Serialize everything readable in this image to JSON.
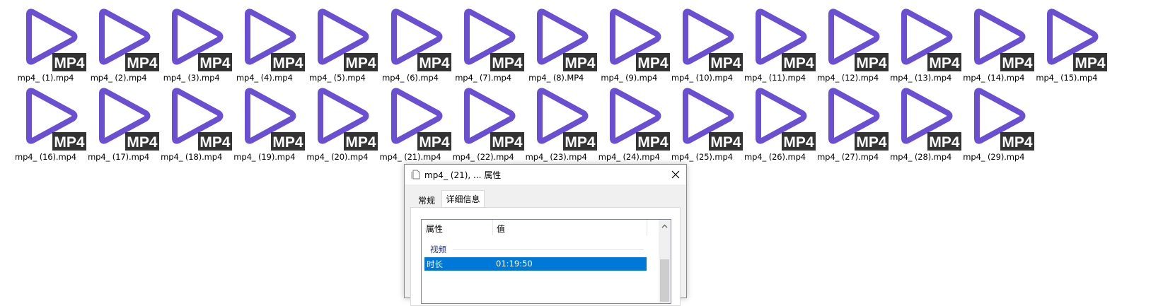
{
  "files": {
    "icon_label": "MP4",
    "icon_color": "#6a4fd3",
    "badge_color": "#333333",
    "items": [
      "mp4_ (1).mp4",
      "mp4_ (2).mp4",
      "mp4_ (3).mp4",
      "mp4_ (4).mp4",
      "mp4_ (5).mp4",
      "mp4_ (6).mp4",
      "mp4_ (7).mp4",
      "mp4_ (8).MP4",
      "mp4_ (9).mp4",
      "mp4_ (10).mp4",
      "mp4_ (11).mp4",
      "mp4_ (12).mp4",
      "mp4_ (13).mp4",
      "mp4_ (14).mp4",
      "mp4_ (15).mp4",
      "mp4_ (16).mp4",
      "mp4_ (17).mp4",
      "mp4_ (18).mp4",
      "mp4_ (19).mp4",
      "mp4_ (20).mp4",
      "mp4_ (21).mp4",
      "mp4_ (22).mp4",
      "mp4_ (23).mp4",
      "mp4_ (24).mp4",
      "mp4_ (25).mp4",
      "mp4_ (26).mp4",
      "mp4_ (27).mp4",
      "mp4_ (28).mp4",
      "mp4_ (29).mp4"
    ]
  },
  "dialog": {
    "title": "mp4_ (21), ... 属性",
    "close_icon": "close-icon",
    "tabs": [
      {
        "label": "常规",
        "active": false
      },
      {
        "label": "详细信息",
        "active": true
      }
    ],
    "columns": {
      "property": "属性",
      "value": "值"
    },
    "group": "视频",
    "selected_row": {
      "name": "时长",
      "value": "01:19:50"
    },
    "selection_color": "#0078d7"
  }
}
